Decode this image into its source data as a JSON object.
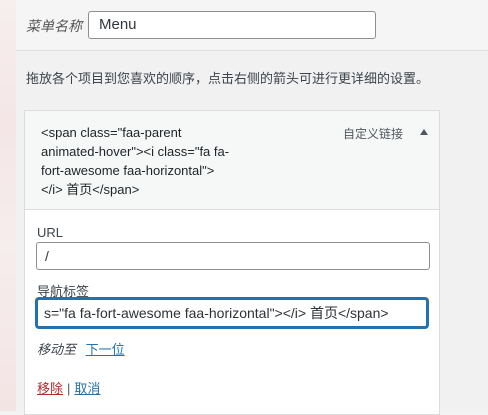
{
  "menu_name": {
    "label": "菜单名称",
    "value": "Menu"
  },
  "instructions": "拖放各个项目到您喜欢的顺序，点击右侧的箭头可进行更详细的设置。",
  "menu_item": {
    "title": "<span class=\"faa-parent\nanimated-hover\"><i class=\"fa fa-\nfort-awesome faa-horizontal\">\n</i> 首页</span>",
    "type_label": "自定义链接",
    "url_label": "URL",
    "url_value": "/",
    "nav_label_label": "导航标签",
    "nav_label_value": "s=\"fa fa-fort-awesome faa-horizontal\"></i> 首页</span>",
    "move_label": "移动至",
    "move_link": "下一位",
    "remove_link": "移除",
    "separator": "|",
    "cancel_link": "取消"
  },
  "colors": {
    "accent": "#2271b1",
    "remove": "#b32d2e"
  }
}
